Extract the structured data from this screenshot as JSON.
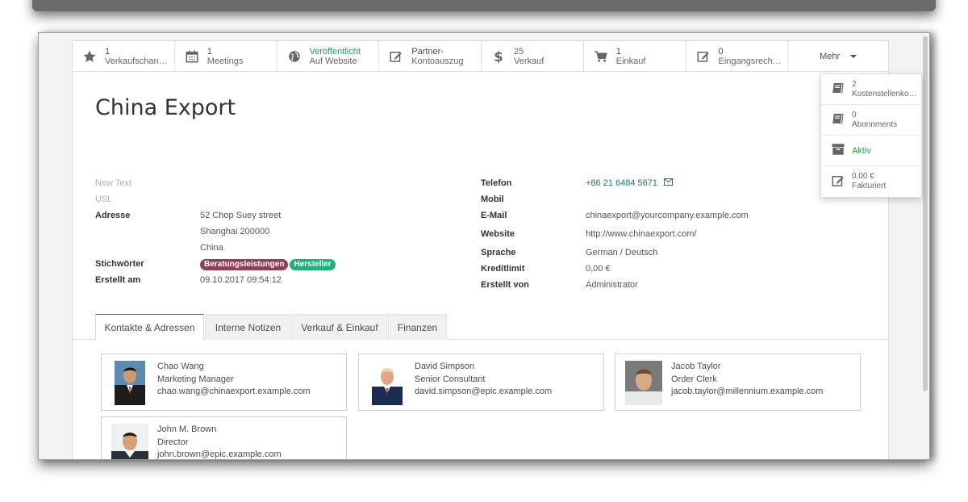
{
  "stat_buttons": [
    {
      "icon": "star-icon",
      "number": "1",
      "label": "Verkaufschancen"
    },
    {
      "icon": "calendar-icon",
      "number": "1",
      "label": "Meetings"
    },
    {
      "icon": "globe-icon",
      "number": "Veröffentlicht",
      "label": "Auf Website"
    },
    {
      "icon": "edit-icon",
      "number": "Partner-",
      "label": "Kontoauszug"
    },
    {
      "icon": "dollar-icon",
      "number": "25",
      "label": "Verkauf"
    },
    {
      "icon": "cart-icon",
      "number": "1",
      "label": "Einkauf"
    },
    {
      "icon": "edit-icon",
      "number": "0",
      "label": "Eingangsrechnungen"
    }
  ],
  "more_label": "Mehr",
  "more_menu": [
    {
      "icon": "book-icon",
      "number": "2",
      "label": "Kostenstellenkonten"
    },
    {
      "icon": "book-icon",
      "number": "0",
      "label": "Abonnments"
    },
    {
      "icon": "archive-icon",
      "number": "",
      "label": "Aktiv"
    },
    {
      "icon": "edit-icon",
      "number": "0,00 €",
      "label": "Fakturiert"
    }
  ],
  "partner": {
    "name": "China Export",
    "left_fields": {
      "new_text_label": "New Text",
      "ust_label": "USt.",
      "address_label": "Adresse",
      "address_lines": [
        "52 Chop Suey street",
        "Shanghai  200000",
        "China"
      ],
      "tags_label": "Stichwörter",
      "tags": [
        {
          "name": "Beratungsleistungen",
          "color": "#8e3f5a"
        },
        {
          "name": "Hersteller",
          "color": "#21b07a"
        }
      ],
      "created_label": "Erstellt am",
      "created_value": "09.10.2017 09:54:12"
    },
    "right_fields": {
      "phone_label": "Telefon",
      "phone_value": "+86 21 6484 5671",
      "mobile_label": "Mobil",
      "email_label": "E-Mail",
      "email_value": "chinaexport@yourcompany.example.com",
      "website_label": "Website",
      "website_value": "http://www.chinaexport.com/",
      "language_label": "Sprache",
      "language_value": "German / Deutsch",
      "credit_label": "Kreditlimit",
      "credit_value": "0,00 €",
      "created_by_label": "Erstellt von",
      "created_by_value": "Administrator"
    }
  },
  "tabs": [
    "Kontakte & Adressen",
    "Interne Notizen",
    "Verkauf & Einkauf",
    "Finanzen"
  ],
  "contacts": [
    {
      "name": "Chao Wang",
      "title": "Marketing Manager",
      "email": "chao.wang@chinaexport.example.com"
    },
    {
      "name": "David Simpson",
      "title": "Senior Consultant",
      "email": "david.simpson@epic.example.com"
    },
    {
      "name": "Jacob Taylor",
      "title": "Order Clerk",
      "email": "jacob.taylor@millennium.example.com"
    },
    {
      "name": "John M. Brown",
      "title": "Director",
      "email": "john.brown@epic.example.com"
    }
  ]
}
